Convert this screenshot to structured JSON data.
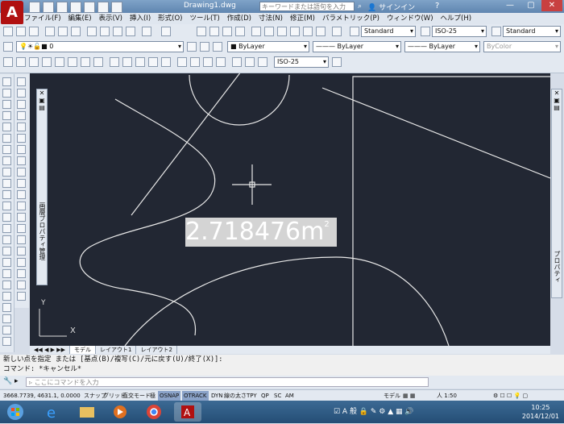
{
  "window": {
    "title": "Drawing1.dwg",
    "search_placeholder": "キーワードまたは語句を入力",
    "signin": "サインイン"
  },
  "menu": [
    "ファイル(F)",
    "編集(E)",
    "表示(V)",
    "挿入(I)",
    "形式(O)",
    "ツール(T)",
    "作成(D)",
    "寸法(N)",
    "修正(M)",
    "パラメトリック(P)",
    "ウィンドウ(W)",
    "ヘルプ(H)"
  ],
  "toolbar2": {
    "text_style": "Standard",
    "dim_style": "ISO-25",
    "table_style": "Standard"
  },
  "toolbar3": {
    "layer": "0",
    "color": "ByLayer",
    "linetype": "ByLayer",
    "lineweight": "ByLayer",
    "plotstyle": "ByColor"
  },
  "toolbar4": {
    "dim_style2": "ISO-25"
  },
  "palette_left": {
    "label": "画層プロパティ管理"
  },
  "palette_right": {
    "label": "プロパティ"
  },
  "drawing": {
    "area_text": "2.718476",
    "unit": "m",
    "unit_sup": "2",
    "ucs_y": "Y",
    "ucs_x": "X"
  },
  "tabs": [
    "モデル",
    "レイアウト1",
    "レイアウト2"
  ],
  "command": {
    "history_1": "新しい点を指定 または [基点(B)/複写(C)/元に戻す(U)/終了(X)]:",
    "history_2": "コマンド: *キャンセル*",
    "placeholder": "ここにコマンドを入力"
  },
  "status": {
    "coords": "3668.7739, 4631.1, 0.0000",
    "items": [
      "スナップ",
      "グリッド",
      "直交モード",
      "極",
      "OSNAP",
      "OTRACK",
      "DYN",
      "線の太さ",
      "TPY",
      "QP",
      "SC",
      "AM"
    ],
    "model": "モデル",
    "scale": "1:50"
  },
  "taskbar": {
    "time": "10:25",
    "date": "2014/12/01"
  },
  "colors": {
    "canvas": "#222733",
    "accent": "#b01010"
  }
}
